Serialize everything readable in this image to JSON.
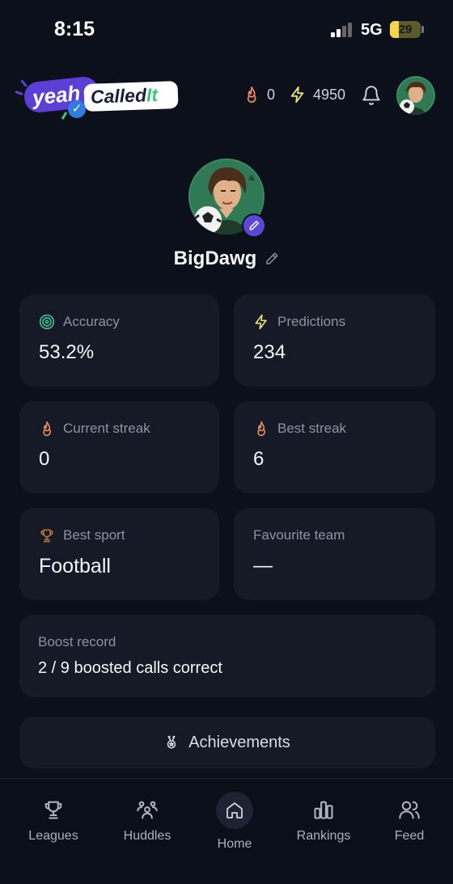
{
  "status_bar": {
    "time": "8:15",
    "network": "5G",
    "battery": "29",
    "battery_level": 0.29
  },
  "header": {
    "logo_text": {
      "part1": "yeah",
      "part2": "Called",
      "part3": "It"
    },
    "streak_count": "0",
    "points": "4950",
    "icons": {
      "streak": "flame-icon",
      "points": "lightning-icon",
      "notifications": "bell-icon"
    }
  },
  "profile": {
    "username": "BigDawg"
  },
  "stats": {
    "accuracy": {
      "label": "Accuracy",
      "value": "53.2%"
    },
    "predictions": {
      "label": "Predictions",
      "value": "234"
    },
    "current_streak": {
      "label": "Current streak",
      "value": "0"
    },
    "best_streak": {
      "label": "Best streak",
      "value": "6"
    },
    "best_sport": {
      "label": "Best sport",
      "value": "Football"
    },
    "favourite_team": {
      "label": "Favourite team",
      "value": "—"
    }
  },
  "boost": {
    "label": "Boost record",
    "value": "2 / 9 boosted calls correct"
  },
  "achievements_label": "Achievements",
  "nav": [
    {
      "label": "Leagues",
      "icon": "trophy-icon"
    },
    {
      "label": "Huddles",
      "icon": "group-icon"
    },
    {
      "label": "Home",
      "icon": "home-icon"
    },
    {
      "label": "Rankings",
      "icon": "bar-chart-icon"
    },
    {
      "label": "Feed",
      "icon": "users-icon"
    }
  ],
  "colors": {
    "background": "#0c101b",
    "card": "#151a26",
    "accent_purple": "#5c48d4",
    "accuracy_green": "#3fbf93",
    "lightning_yellow": "#e8e07a",
    "flame_orange": "#e8875a",
    "trophy_brown": "#b8743a"
  }
}
